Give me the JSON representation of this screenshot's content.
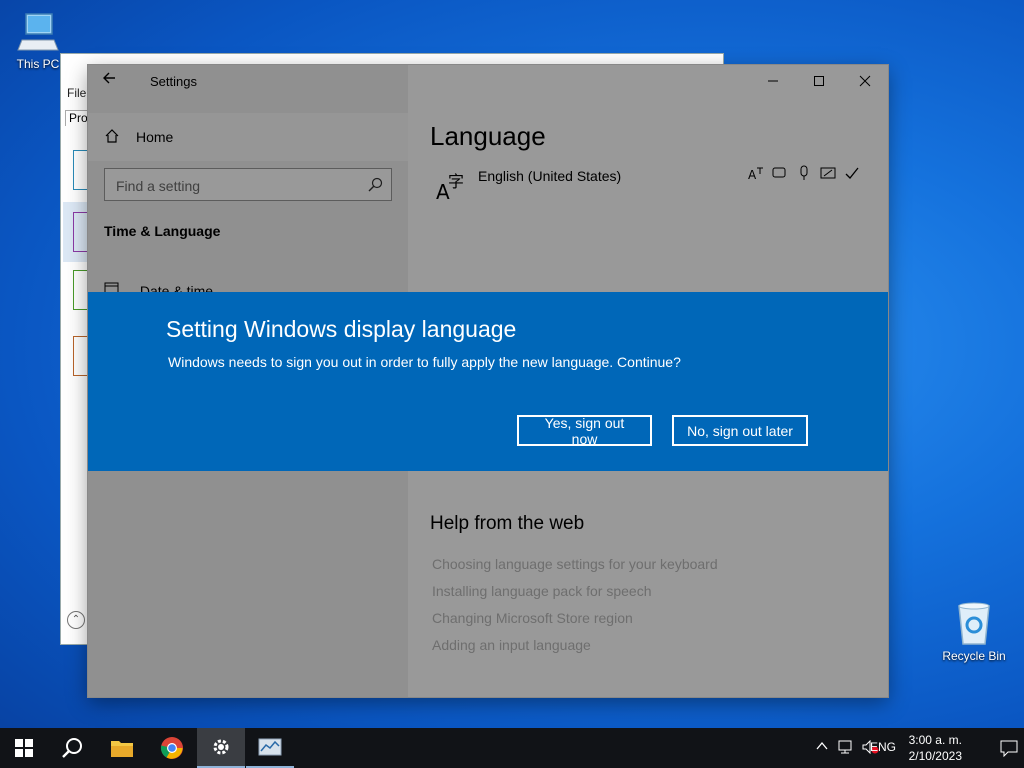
{
  "desktop": {
    "icons": [
      {
        "label": "This PC"
      },
      {
        "label": "Recycle Bin"
      }
    ]
  },
  "background_window": {
    "menu_text": "File",
    "tab_text": "Proc"
  },
  "settings": {
    "app_title": "Settings",
    "nav": {
      "home": "Home",
      "search_placeholder": "Find a setting",
      "section": "Time & Language",
      "items": [
        {
          "label": "Date & time"
        }
      ]
    },
    "content": {
      "page_title": "Language",
      "language_name": "English (United States)",
      "help_title": "Help from the web",
      "help_links": [
        "Choosing language settings for your keyboard",
        "Installing language pack for speech",
        "Changing Microsoft Store region",
        "Adding an input language"
      ]
    }
  },
  "dialog": {
    "title": "Setting Windows display language",
    "body": "Windows needs to sign you out in order to fully apply the new language. Continue?",
    "yes_label": "Yes, sign out now",
    "no_label": "No, sign out later"
  },
  "taskbar": {
    "language": "ENG",
    "time": "3:00 a. m.",
    "date": "2/10/2023"
  },
  "colors": {
    "accent": "#0067b8",
    "taskbar": "#111317"
  }
}
